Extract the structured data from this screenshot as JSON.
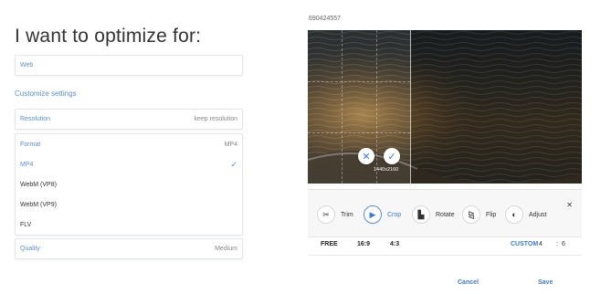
{
  "left": {
    "title": "I want to optimize for:",
    "target_value": "Web",
    "customize_link": "Customize settings",
    "resolution": {
      "label": "Resolution",
      "value": "keep resolution"
    },
    "format": {
      "label": "Format",
      "value": "MP4",
      "options": [
        {
          "label": "MP4",
          "selected": true
        },
        {
          "label": "WebM (VP8)",
          "selected": false
        },
        {
          "label": "WebM (VP9)",
          "selected": false
        },
        {
          "label": "FLV",
          "selected": false
        }
      ]
    },
    "quality": {
      "label": "Quality",
      "value": "Medium"
    }
  },
  "right": {
    "filename": "690424557",
    "crop_dimensions": "1440x2160",
    "tools": [
      {
        "label": "Trim",
        "icon": "scissors-icon",
        "active": false
      },
      {
        "label": "Crop",
        "icon": "crop-play-icon",
        "active": true
      },
      {
        "label": "Rotate",
        "icon": "rotate-icon",
        "active": false
      },
      {
        "label": "Flip",
        "icon": "flip-icon",
        "active": false
      },
      {
        "label": "Adjust",
        "icon": "adjust-icon",
        "active": false
      }
    ],
    "close_glyph": "✕",
    "ratios": {
      "free": "FREE",
      "r169": "16:9",
      "r43": "4:3",
      "custom": "CUSTOM",
      "custom_w": "4",
      "custom_sep": ":",
      "custom_h": "6"
    }
  },
  "footer": {
    "cancel": "Cancel",
    "save": "Save"
  },
  "colors": {
    "accent": "#3a7bd5",
    "label_blue": "#5b8ed3"
  }
}
